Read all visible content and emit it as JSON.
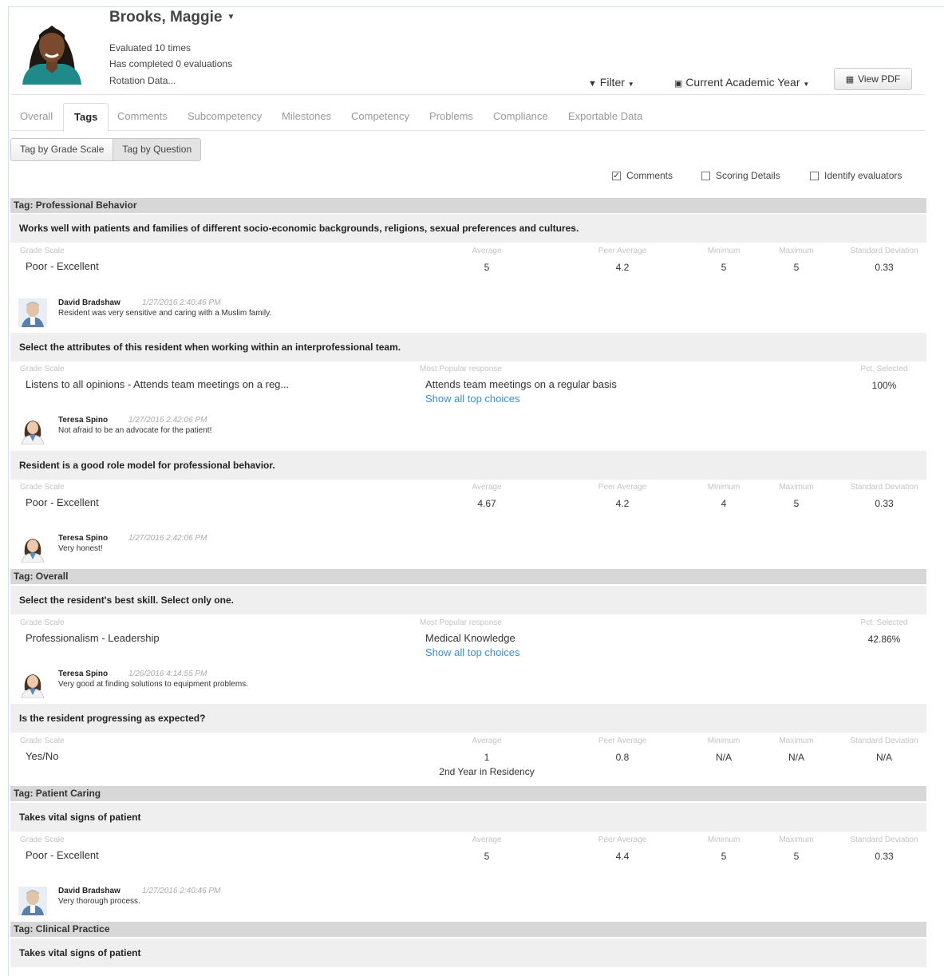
{
  "profile": {
    "name": "Brooks, Maggie",
    "evaluated": "Evaluated 10 times",
    "completed": "Has completed 0 evaluations",
    "rotation": "Rotation Data..."
  },
  "toolbar": {
    "filter_label": "Filter",
    "year_label": "Current Academic Year",
    "pdf_label": "View PDF"
  },
  "tabs": [
    "Overall",
    "Tags",
    "Comments",
    "Subcompetency",
    "Milestones",
    "Competency",
    "Problems",
    "Compliance",
    "Exportable Data"
  ],
  "active_tab": "Tags",
  "seg": {
    "grade": "Tag by Grade Scale",
    "question": "Tag by Question"
  },
  "options": {
    "comments": "Comments",
    "comments_checked": true,
    "scoring": "Scoring Details",
    "scoring_checked": false,
    "identify": "Identify evaluators",
    "identify_checked": false
  },
  "headers": {
    "grade_scale": "Grade Scale",
    "average": "Average",
    "peer_average": "Peer Average",
    "minimum": "Minimum",
    "maximum": "Maximum",
    "std_dev": "Standard Deviation",
    "most_popular": "Most Popular response",
    "pct_selected": "Pct. Selected",
    "show_all": "Show all top choices"
  },
  "sections": [
    {
      "tag": "Tag: Professional Behavior",
      "questions": [
        {
          "text": "Works well with patients and families of different socio-economic backgrounds, religions, sexual preferences and cultures.",
          "scale": "Poor - Excellent",
          "average": "5",
          "peer_average": "4.2",
          "minimum": "5",
          "maximum": "5",
          "std_dev": "0.33",
          "comment": {
            "author": "David Bradshaw",
            "date": "1/27/2016 2:40:46 PM",
            "text": "Resident was very sensitive and caring with a Muslim family."
          }
        },
        {
          "text": "Select the attributes of this resident when working within an interprofessional team.",
          "scale": "Listens to all opinions - Attends team meetings on a reg...",
          "popular": "Attends team meetings on a regular basis",
          "pct": "100%",
          "comment": {
            "author": "Teresa Spino",
            "date": "1/27/2016 2:42:06 PM",
            "text": "Not afraid to be an advocate for the patient!"
          }
        },
        {
          "text": "Resident is a good role model for professional behavior.",
          "scale": "Poor - Excellent",
          "average": "4.67",
          "peer_average": "4.2",
          "minimum": "4",
          "maximum": "5",
          "std_dev": "0.33",
          "comment": {
            "author": "Teresa Spino",
            "date": "1/27/2016 2:42:06 PM",
            "text": "Very honest!"
          }
        }
      ]
    },
    {
      "tag": "Tag: Overall",
      "questions": [
        {
          "text": "Select the resident's best skill. Select only one.",
          "scale": "Professionalism - Leadership",
          "popular": "Medical Knowledge",
          "pct": "42.86%",
          "comment": {
            "author": "Teresa Spino",
            "date": "1/26/2016 4:14:55 PM",
            "text": "Very good at finding solutions to equipment problems."
          }
        },
        {
          "text": "Is the resident progressing as expected?",
          "scale": "Yes/No",
          "average": "1",
          "average_note": "2nd Year in Residency",
          "peer_average": "0.8",
          "minimum": "N/A",
          "maximum": "N/A",
          "std_dev": "N/A"
        }
      ]
    },
    {
      "tag": "Tag: Patient Caring",
      "questions": [
        {
          "text": "Takes vital signs of patient",
          "scale": "Poor - Excellent",
          "average": "5",
          "peer_average": "4.4",
          "minimum": "5",
          "maximum": "5",
          "std_dev": "0.33",
          "comment": {
            "author": "David Bradshaw",
            "date": "1/27/2016 2:40:46 PM",
            "text": "Very thorough process."
          }
        }
      ]
    },
    {
      "tag": "Tag: Clinical Practice",
      "questions": [
        {
          "text": "Takes vital signs of patient"
        }
      ]
    }
  ],
  "colors": {
    "link": "#3a8fd0",
    "tag_band": "#d7d7d7",
    "question_band": "#efefef",
    "border": "#cfe3ef"
  },
  "icons": {
    "filter": "filter-icon",
    "calendar": "calendar-icon",
    "pdf": "document-icon",
    "checkbox": "check-icon"
  }
}
